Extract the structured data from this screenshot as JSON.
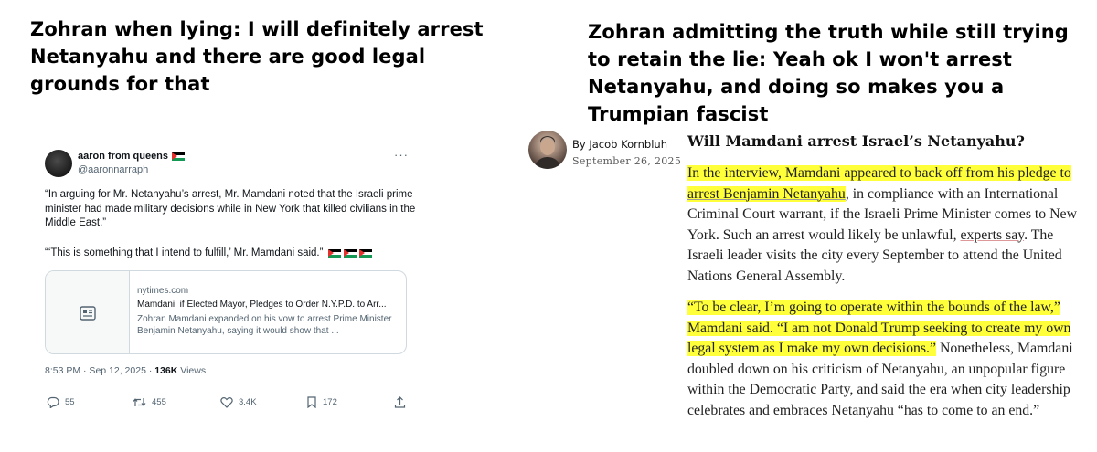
{
  "captions": {
    "left": "Zohran when lying: I will definitely arrest Netanyahu and there are good legal grounds for that",
    "right": "Zohran admitting the truth while still trying to retain the lie: Yeah ok I won't arrest Netanyahu, and doing so makes you a Trumpian fascist"
  },
  "tweet": {
    "display_name": "aaron from queens",
    "handle": "@aaronnarraph",
    "more_glyph": "···",
    "text1": "“In arguing for Mr. Netanyahu’s arrest, Mr. Mamdani noted that the Israeli prime minister had made military decisions while in New York that killed civilians in the Middle East.”",
    "text2": "“‘This is something that I intend to fulfill,’ Mr. Mamdani said.”",
    "link_card": {
      "domain": "nytimes.com",
      "title": "Mamdani, if Elected Mayor, Pledges to Order N.Y.P.D. to Arr...",
      "description": "Zohran Mamdani expanded on his vow to arrest Prime Minister Benjamin Netanyahu, saying it would show that ..."
    },
    "timestamp": "8:53 PM · Sep 12, 2025 · ",
    "views_count": "136K",
    "views_label": " Views",
    "actions": {
      "replies": "55",
      "reposts": "455",
      "likes": "3.4K",
      "bookmarks": "172"
    },
    "flag_colors": [
      "#000000",
      "#ffffff",
      "#149954",
      "#e4312b"
    ]
  },
  "article": {
    "byline_prefix": "By ",
    "author": "Jacob Kornbluh",
    "date": "September 26, 2025",
    "headline": "Will Mamdani arrest Israel’s Netanyahu?",
    "para1": {
      "hl1": "In the interview, Mamdani appeared to back off from his pledge to ",
      "hl_link": "arrest Benjamin Netanyahu",
      "rest1": ", in compliance with an International Criminal Court warrant, if the Israeli Prime Minister comes to New York. Such an arrest would likely be unlawful, ",
      "link2": "experts say",
      "rest2": ". The Israeli leader visits the city every September to attend the United Nations General Assembly."
    },
    "para2": {
      "hl": "“To be clear, I’m going to operate within the bounds of the law,” Mamdani said. “I am not Donald Trump seeking to create my own legal system as I make my own decisions.”",
      "rest": " Nonetheless, Mamdani doubled down on his criticism of Netanyahu, an unpopular figure within the Democratic Party, and said the era when city leadership celebrates and embraces Netanyahu “has to come to an end.”"
    },
    "highlight_color": "#ffff3a"
  }
}
